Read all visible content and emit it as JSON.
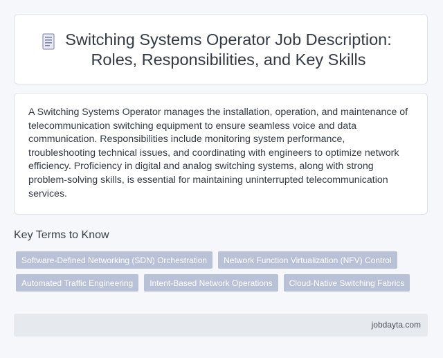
{
  "header": {
    "icon": "document-list-icon",
    "title_line1": "Switching Systems Operator Job Description:",
    "title_line2": "Roles, Responsibilities, and Key Skills"
  },
  "description": "A Switching Systems Operator manages the installation, operation, and maintenance of telecommunication switching equipment to ensure seamless voice and data communication. Responsibilities include monitoring system performance, troubleshooting technical issues, and coordinating with engineers to optimize network efficiency. Proficiency in digital and analog switching systems, along with strong problem-solving skills, is essential for maintaining uninterrupted telecommunication services.",
  "key_terms": {
    "heading": "Key Terms to Know",
    "tags": [
      "Software-Defined Networking (SDN) Orchestration",
      "Network Function Virtualization (NFV) Control",
      "Automated Traffic Engineering",
      "Intent-Based Network Operations",
      "Cloud-Native Switching Fabrics"
    ]
  },
  "footer": {
    "site": "jobdayta.com"
  },
  "colors": {
    "background": "#f5f7fa",
    "tag_background": "#b9c1d6",
    "footer_background": "#e6eaee"
  }
}
